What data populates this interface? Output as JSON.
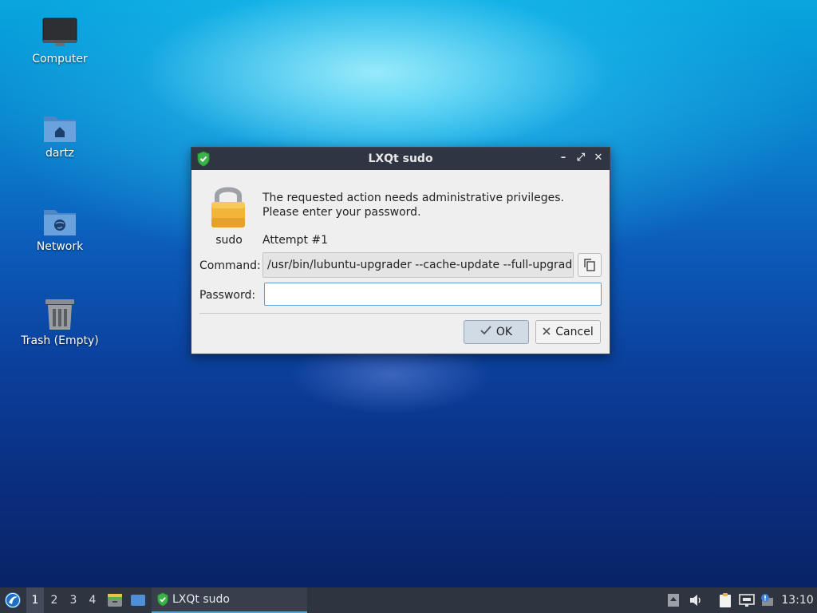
{
  "desktop": {
    "icons": [
      {
        "label": "Computer",
        "icon": "monitor-icon"
      },
      {
        "label": "dartz",
        "icon": "home-folder-icon"
      },
      {
        "label": "Network",
        "icon": "network-folder-icon"
      },
      {
        "label": "Trash (Empty)",
        "icon": "trash-icon"
      }
    ]
  },
  "dialog": {
    "title": "LXQt sudo",
    "message_line1": "The requested action needs administrative privileges.",
    "message_line2": "Please enter your password.",
    "icon_label": "sudo",
    "attempt": "Attempt #1",
    "command_label": "Command:",
    "command_value": "/usr/bin/lubuntu-upgrader --cache-update --full-upgrade",
    "password_label": "Password:",
    "password_value": "",
    "ok_label": "OK",
    "cancel_label": "Cancel",
    "title_controls": {
      "minimize": "–",
      "maximize": "⤢",
      "close": "✕"
    }
  },
  "taskbar": {
    "workspaces": [
      "1",
      "2",
      "3",
      "4"
    ],
    "active_workspace": "1",
    "task_label": "LXQt sudo",
    "clock": "13:10"
  },
  "colors": {
    "titlebar": "#2f3542",
    "taskbar": "#2e3440",
    "accent": "#5aa0d8"
  }
}
